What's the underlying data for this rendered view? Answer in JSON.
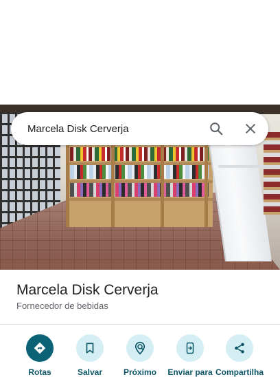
{
  "search": {
    "query": "Marcela Disk Cerverja"
  },
  "place": {
    "name": "Marcela Disk Cerverja",
    "category": "Fornecedor de bebidas"
  },
  "actions": [
    {
      "label": "Rotas",
      "icon": "directions-icon"
    },
    {
      "label": "Salvar",
      "icon": "bookmark-icon"
    },
    {
      "label": "Próximo",
      "icon": "nearby-icon"
    },
    {
      "label": "Enviar para",
      "icon": "send-to-phone-icon"
    },
    {
      "label": "Compartilha",
      "icon": "share-icon"
    }
  ],
  "colors": {
    "primary_action": "#0b6277",
    "action_bg": "#d5eef4",
    "action_label": "#0b5566",
    "title": "#202124",
    "subtitle": "#5f6368"
  }
}
